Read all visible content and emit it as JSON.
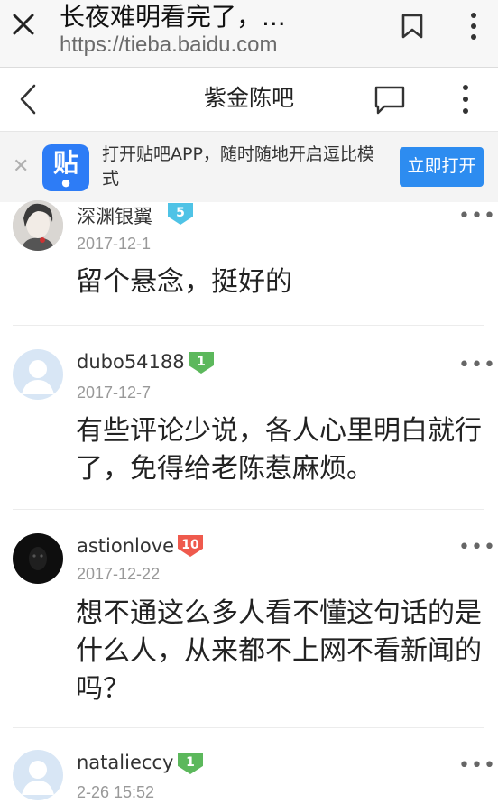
{
  "browser": {
    "title": "长夜难明看完了，...",
    "url": "https://tieba.baidu.com"
  },
  "nav": {
    "title": "紫金陈吧"
  },
  "banner": {
    "text": "打开贴吧APP，随时随地开启逗比模式",
    "logo_char": "贴",
    "button_label": "立即打开"
  },
  "posts": [
    {
      "username": "深渊银翼",
      "level": "5",
      "level_color": "#4fc3e6",
      "date": "2017-12-1",
      "content": "留个悬念，挺好的"
    },
    {
      "username": "dubo54188",
      "level": "1",
      "level_color": "#5cb85c",
      "date": "2017-12-7",
      "content": "有些评论少说，各人心里明白就行了，免得给老陈惹麻烦。"
    },
    {
      "username": "astionlove",
      "level": "10",
      "level_color": "#ef5a4d",
      "date": "2017-12-22",
      "content": "想不通这么多人看不懂这句话的是什么人，从来都不上网不看新闻的吗？"
    },
    {
      "username": "natalieccy",
      "level": "1",
      "level_color": "#5cb85c",
      "date": "2-26 15:52",
      "content": ""
    }
  ],
  "more_glyph": "•••",
  "icons": [
    "close-icon",
    "bookmark-icon",
    "more-vertical-icon",
    "back-arrow-icon",
    "comment-icon",
    "paw-icon"
  ]
}
